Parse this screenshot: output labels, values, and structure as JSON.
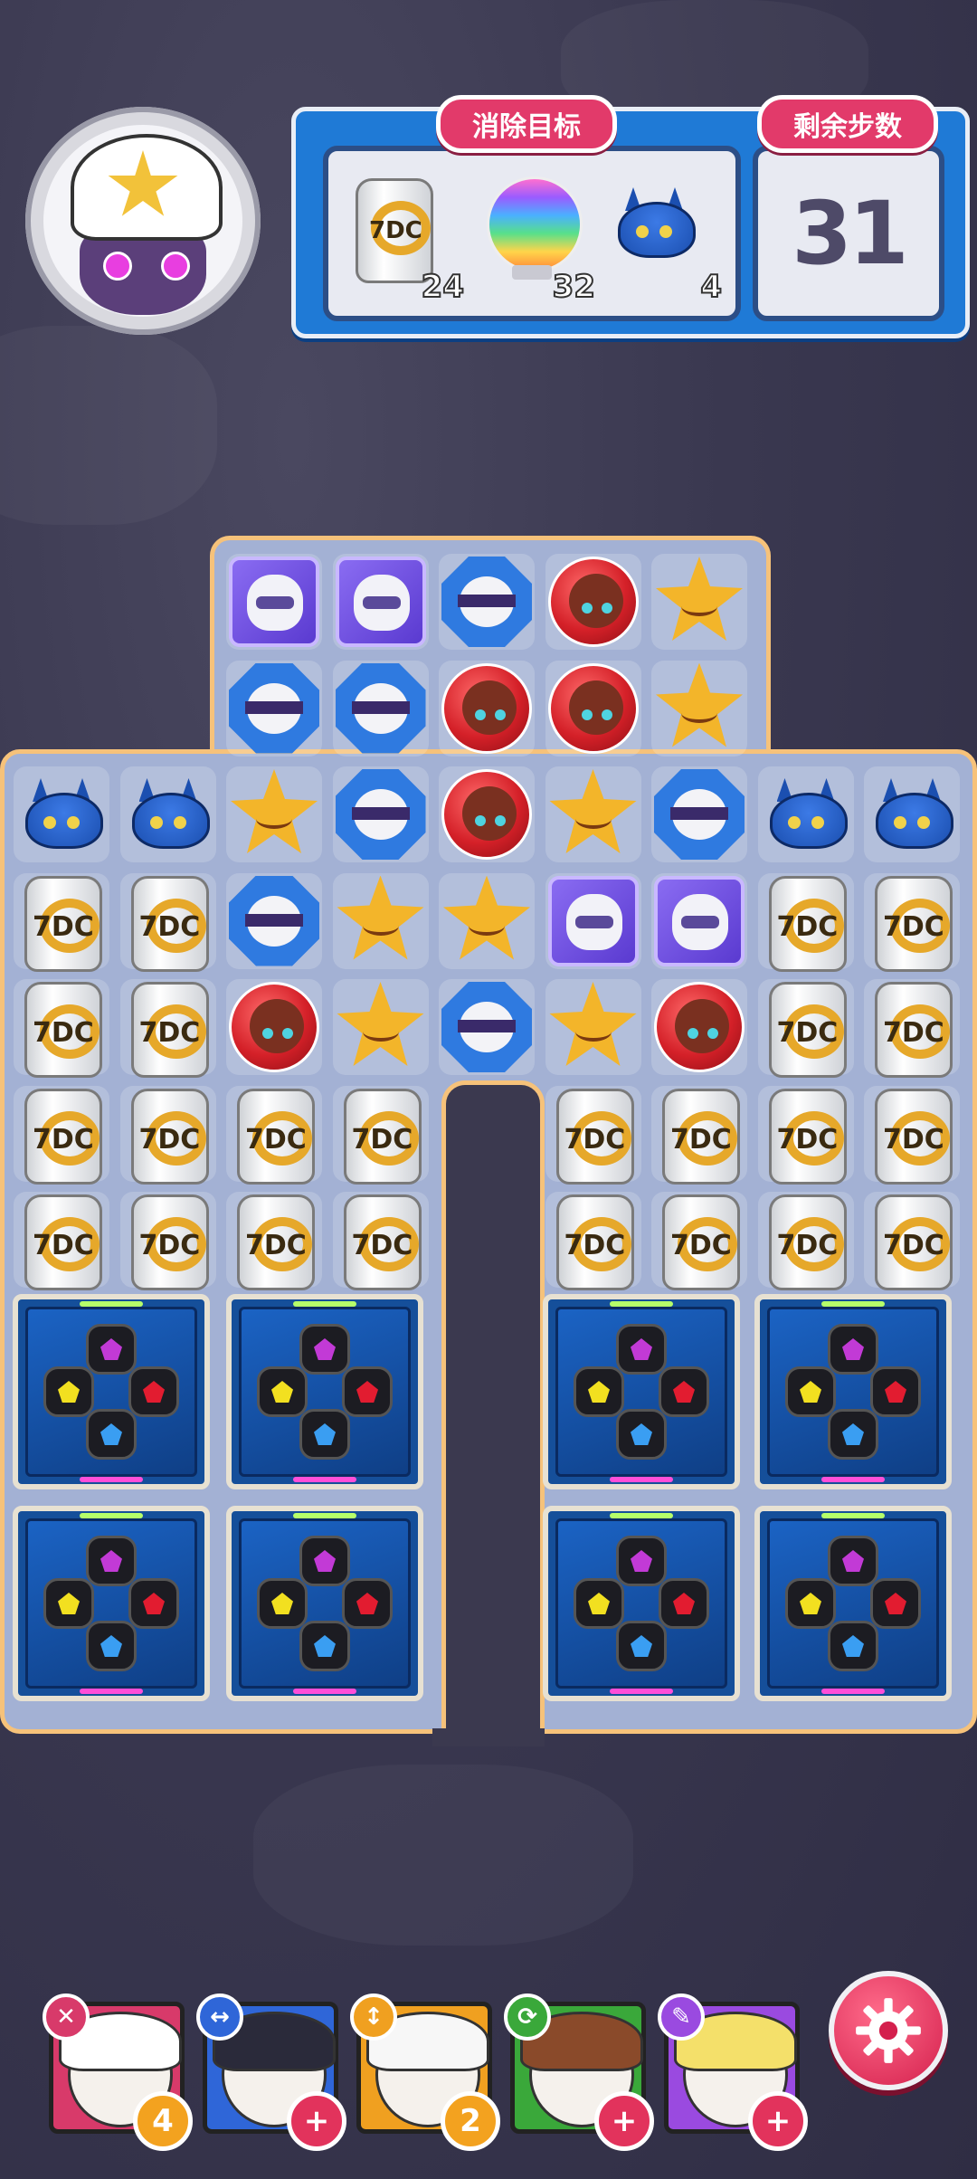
{
  "goals_panel": {
    "title": "消除目标",
    "items": [
      {
        "name": "can-goal",
        "icon": "can-icon",
        "count": "24"
      },
      {
        "name": "orb-goal",
        "icon": "rainbow-orb-icon",
        "count": "32"
      },
      {
        "name": "crab-goal",
        "icon": "blue-crab-icon",
        "count": "4"
      }
    ]
  },
  "steps_panel": {
    "title": "剩余步数",
    "value": "31"
  },
  "board": {
    "top_rows": [
      [
        "purple",
        "purple",
        "oct",
        "red",
        "star"
      ],
      [
        "oct",
        "oct",
        "red",
        "red",
        "star"
      ]
    ],
    "rows": [
      [
        "crab",
        "crab",
        "star",
        "oct",
        "red",
        "star",
        "oct",
        "crab",
        "crab"
      ],
      [
        "can",
        "can",
        "oct",
        "star",
        "star",
        "purple",
        "purple",
        "can",
        "can"
      ],
      [
        "can",
        "can",
        "red",
        "star",
        "oct",
        "star",
        "red",
        "can",
        "can"
      ],
      [
        "can",
        "can",
        "can",
        "can",
        "gap",
        "can",
        "can",
        "can",
        "can"
      ],
      [
        "can",
        "can",
        "can",
        "can",
        "gap",
        "can",
        "can",
        "can",
        "can"
      ]
    ],
    "can_label": "7DC"
  },
  "characters": [
    {
      "name": "star-hat-character",
      "ability_icon": "cross-icon",
      "ability_glyph": "✕",
      "card_color": "#d83a6a",
      "badge_type": "number",
      "badge": "4"
    },
    {
      "name": "visor-character",
      "ability_icon": "horizontal-arrows-icon",
      "ability_glyph": "↔",
      "card_color": "#2f66d8",
      "badge_type": "plus",
      "badge": "+"
    },
    {
      "name": "white-hair-character",
      "ability_icon": "vertical-arrows-icon",
      "ability_glyph": "↕",
      "card_color": "#f0a020",
      "badge_type": "number",
      "badge": "2"
    },
    {
      "name": "brown-hair-character",
      "ability_icon": "cycle-icon",
      "ability_glyph": "⟳",
      "card_color": "#3aa83a",
      "badge_type": "plus",
      "badge": "+"
    },
    {
      "name": "blonde-character",
      "ability_icon": "feather-icon",
      "ability_glyph": "✎",
      "card_color": "#9a4ae0",
      "badge_type": "plus",
      "badge": "+"
    }
  ],
  "settings": {
    "icon": "gear-icon"
  }
}
